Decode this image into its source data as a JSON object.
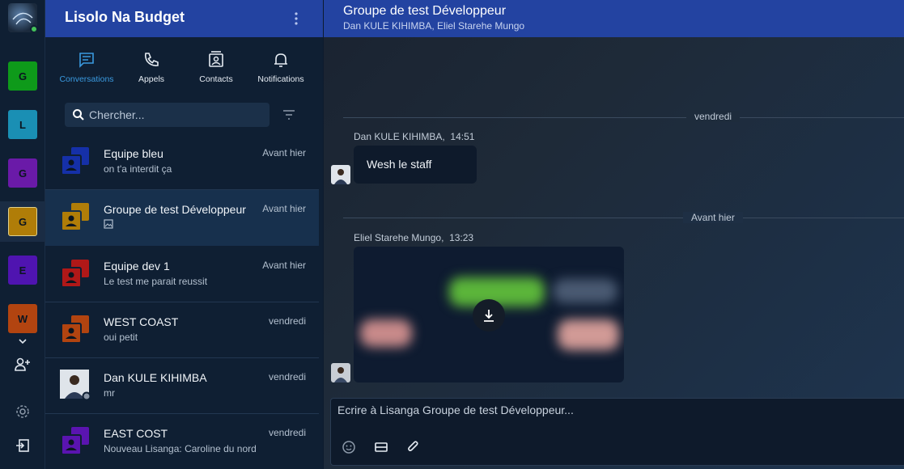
{
  "workspaces": [
    {
      "letter": "G",
      "color": "#0e9a1a"
    },
    {
      "letter": "L",
      "color": "#1a8fb4"
    },
    {
      "letter": "G",
      "color": "#6a1aa8"
    },
    {
      "letter": "G",
      "color": "#b07d08"
    },
    {
      "letter": "E",
      "color": "#4f14b0"
    },
    {
      "letter": "W",
      "color": "#b24410"
    }
  ],
  "sidebar": {
    "title": "Lisolo Na Budget",
    "tabs": [
      {
        "label": "Conversations",
        "icon": "chat-icon"
      },
      {
        "label": "Appels",
        "icon": "phone-icon"
      },
      {
        "label": "Contacts",
        "icon": "contacts-icon"
      },
      {
        "label": "Notifications",
        "icon": "bell-icon"
      }
    ],
    "search_placeholder": "Chercher...",
    "conversations": [
      {
        "name": "Equipe bleu",
        "preview": "on t'a interdit ça",
        "time": "Avant hier",
        "color": "#1530a8",
        "type": "group"
      },
      {
        "name": "Groupe de test Développeur",
        "preview": "",
        "time": "Avant hier",
        "color": "#b07d08",
        "type": "group"
      },
      {
        "name": "Equipe dev 1",
        "preview": "Le test me parait reussit",
        "time": "Avant hier",
        "color": "#b01818",
        "type": "group"
      },
      {
        "name": "WEST COAST",
        "preview": "oui petit",
        "time": "vendredi",
        "color": "#b24410",
        "type": "group"
      },
      {
        "name": "Dan KULE KIHIMBA",
        "preview": "mr",
        "time": "vendredi",
        "color": "#3b3b3b",
        "type": "user"
      },
      {
        "name": "EAST COST",
        "preview": "Nouveau Lisanga: Caroline du nord",
        "time": "vendredi",
        "color": "#5a14b0",
        "type": "group"
      }
    ]
  },
  "chat": {
    "title": "Groupe de test Développeur",
    "members": "Dan KULE KIHIMBA, Eliel Starehe Mungo",
    "dividers": [
      "vendredi",
      "Avant hier"
    ],
    "messages": [
      {
        "sender": "Dan KULE KIHIMBA,",
        "time": "14:51",
        "text": "Wesh le staff"
      },
      {
        "sender": "Eliel Starehe Mungo,",
        "time": "13:23",
        "text": ""
      }
    ],
    "composer_placeholder": "Ecrire à Lisanga Groupe de test Développeur..."
  }
}
